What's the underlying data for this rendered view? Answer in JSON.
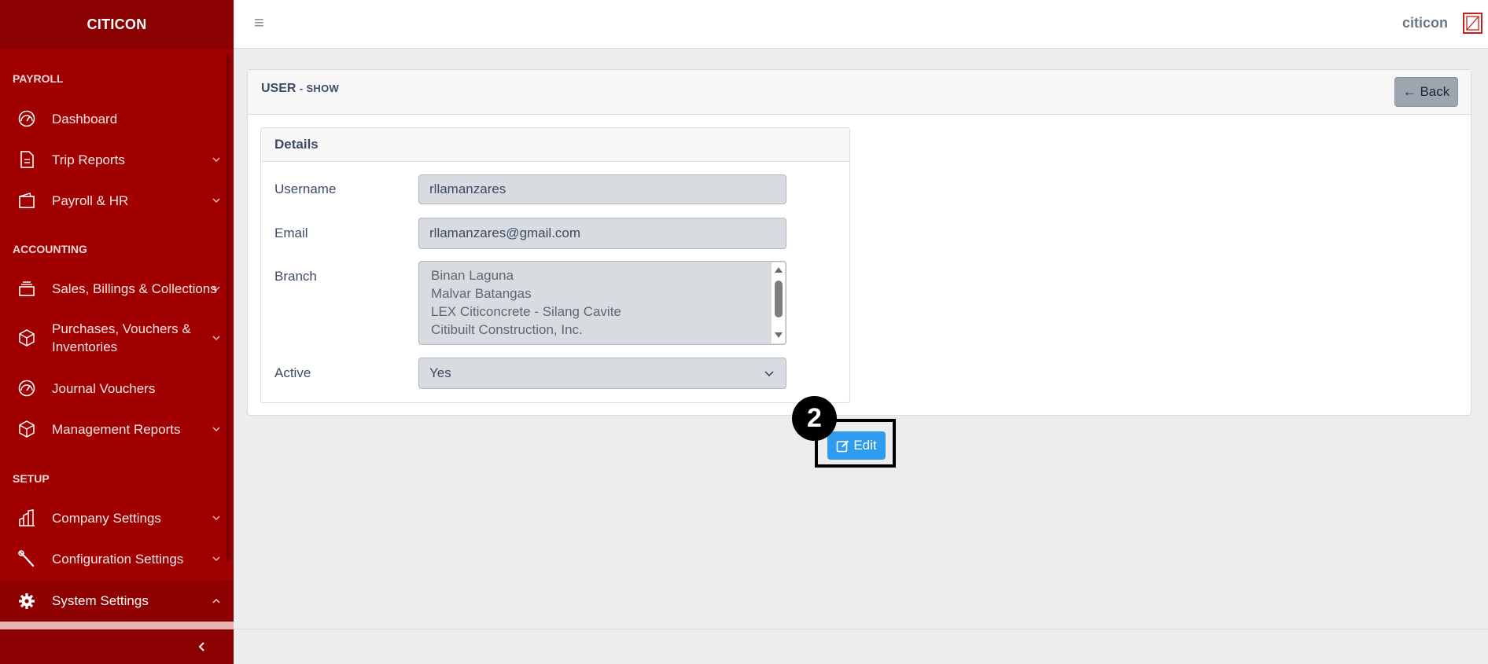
{
  "app": {
    "brand": "CITICON"
  },
  "header": {
    "user_name": "citicon"
  },
  "sidebar": {
    "sections": [
      {
        "title": "PAYROLL"
      },
      {
        "title": "ACCOUNTING"
      },
      {
        "title": "SETUP"
      }
    ],
    "items": [
      {
        "label": "Dashboard",
        "icon": "speedometer-icon",
        "has_submenu": false
      },
      {
        "label": "Trip Reports",
        "icon": "document-icon",
        "has_submenu": true
      },
      {
        "label": "Payroll & HR",
        "icon": "wallet-icon",
        "has_submenu": true
      },
      {
        "label": "Sales, Billings & Collections",
        "icon": "layers-icon",
        "has_submenu": true
      },
      {
        "label_line1": "Purchases, Vouchers &",
        "label_line2": "Inventories",
        "icon": "cube-icon",
        "has_submenu": true
      },
      {
        "label": "Journal Vouchers",
        "icon": "speedometer-icon",
        "has_submenu": false
      },
      {
        "label": "Management Reports",
        "icon": "cube-icon",
        "has_submenu": true
      },
      {
        "label": "Company Settings",
        "icon": "building-icon",
        "has_submenu": true
      },
      {
        "label": "Configuration Settings",
        "icon": "wrench-icon",
        "has_submenu": true
      },
      {
        "label": "System Settings",
        "icon": "gear-icon",
        "has_submenu": true,
        "expanded": true
      }
    ]
  },
  "page": {
    "title": "USER",
    "subtitle": "- SHOW",
    "back_label": "← Back",
    "details_title": "Details",
    "fields": {
      "username": {
        "label": "Username",
        "value": "rllamanzares"
      },
      "email": {
        "label": "Email",
        "value": "rllamanzares@gmail.com"
      },
      "branch": {
        "label": "Branch",
        "options": [
          "Binan Laguna",
          "Malvar Batangas",
          "LEX Citiconcrete - Silang Cavite",
          "Citibuilt Construction, Inc."
        ]
      },
      "active": {
        "label": "Active",
        "value": "Yes"
      }
    },
    "edit_label": "Edit"
  },
  "annotation": {
    "step": "2"
  },
  "colors": {
    "sidebar_bg": "#a10000",
    "sidebar_dark": "#8b0000",
    "primary": "#2f9cf0",
    "back_button": "#9da5b1"
  }
}
